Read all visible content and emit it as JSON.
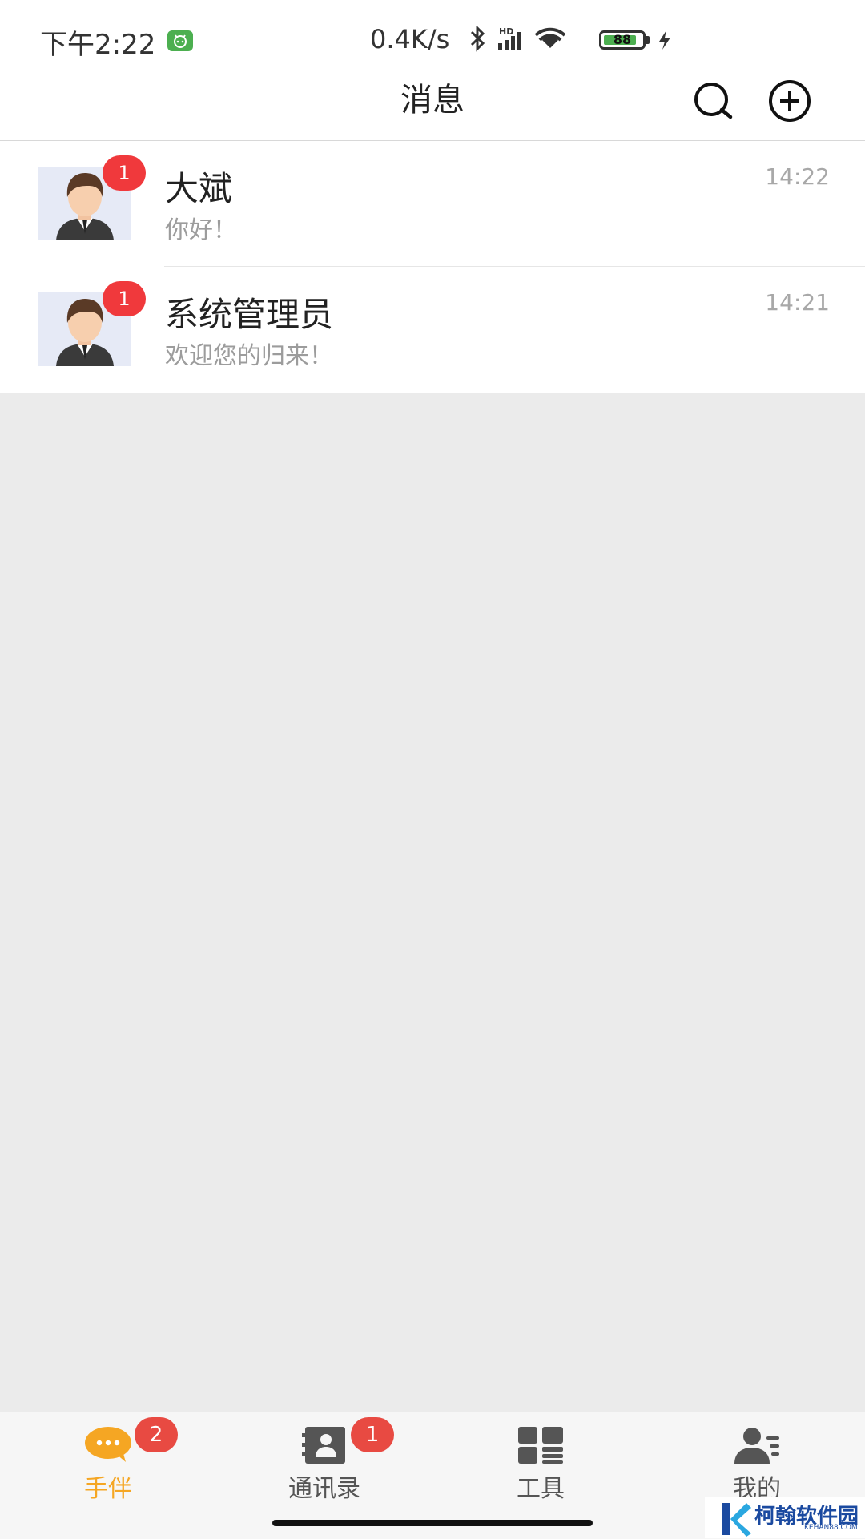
{
  "status_bar": {
    "time": "下午2:22",
    "net_speed": "0.4K/s",
    "signal_label": "HD",
    "battery": "88",
    "battery_level": 0.88
  },
  "header": {
    "title": "消息"
  },
  "conversations": [
    {
      "name": "大斌",
      "preview": "你好！",
      "time": "14:22",
      "unread": "1"
    },
    {
      "name": "系统管理员",
      "preview": "欢迎您的归来！",
      "time": "14:21",
      "unread": "1"
    }
  ],
  "bottom_nav": [
    {
      "label": "手伴",
      "icon": "chat-bubble-icon",
      "badge": "2",
      "active": true
    },
    {
      "label": "通讯录",
      "icon": "contacts-icon",
      "badge": "1",
      "active": false
    },
    {
      "label": "工具",
      "icon": "tools-grid-icon",
      "badge": "",
      "active": false
    },
    {
      "label": "我的",
      "icon": "profile-icon",
      "badge": "",
      "active": false
    }
  ],
  "colors": {
    "accent": "#f5a623",
    "badge": "#f0393c",
    "background": "#ebebeb"
  },
  "watermark": {
    "text": "柯翰软件园",
    "sub": "KEHAN88.COM"
  }
}
